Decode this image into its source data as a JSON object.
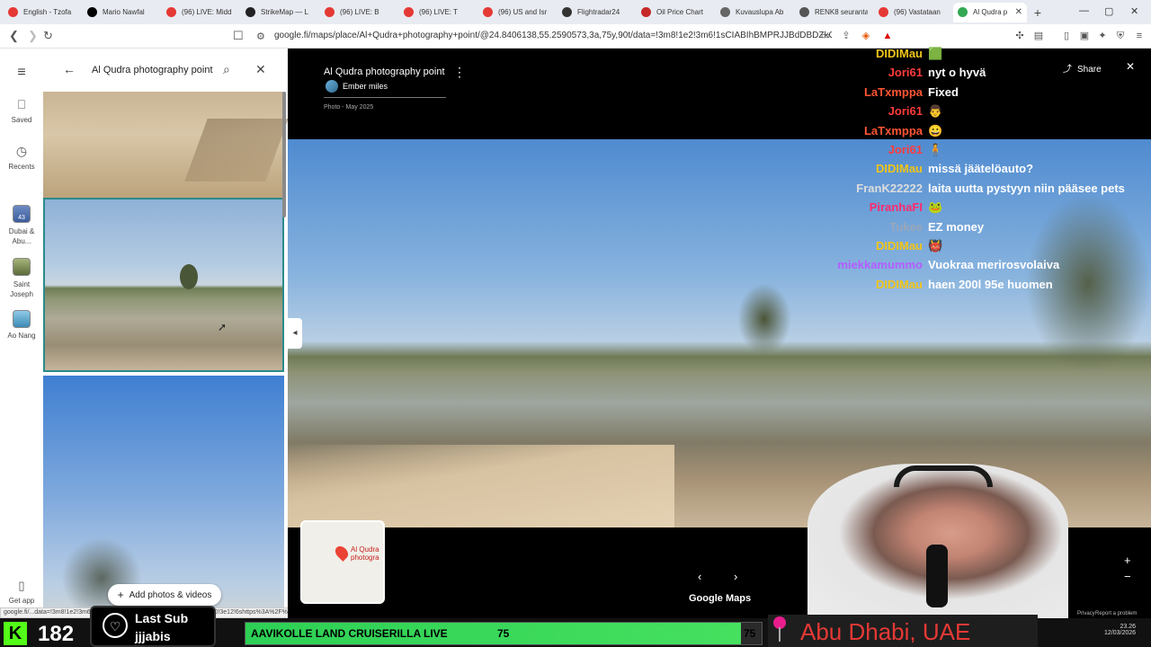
{
  "tabs": [
    {
      "label": "English - Tzofa",
      "color": "#e53935"
    },
    {
      "label": "Mario Nawfal",
      "color": "#000000"
    },
    {
      "label": "(96) LIVE: Midd",
      "color": "#e53935"
    },
    {
      "label": "StrikeMap — L",
      "color": "#222222"
    },
    {
      "label": "(96) LIVE: B",
      "color": "#e53935"
    },
    {
      "label": "(96) LIVE: T",
      "color": "#e53935"
    },
    {
      "label": "(96) US and Isr",
      "color": "#e53935"
    },
    {
      "label": "Flightradar24",
      "color": "#333333"
    },
    {
      "label": "Oil Price Chart",
      "color": "#c62828"
    },
    {
      "label": "Kuvauslupa Ab",
      "color": "#666666"
    },
    {
      "label": "RENK8 seuranta",
      "color": "#555555"
    },
    {
      "label": "(96) Vastataan",
      "color": "#e53935"
    },
    {
      "label": "Al Qudra p",
      "color": "#34a853"
    }
  ],
  "url": "google.fi/maps/place/Al+Qudra+photography+point/@24.8406138,55.2590573,3a,75y,90t/data=!3m8!1e2!3m6!1sCIABIhBMPRJJBdDBDZkGgV...",
  "rail": {
    "saved": "Saved",
    "recents": "Recents",
    "recent_items": [
      {
        "label": "Dubai & Abu...",
        "badge": "43"
      },
      {
        "label": "Saint Joseph"
      },
      {
        "label": "Ao Nang"
      }
    ],
    "get_app": "Get app"
  },
  "search": {
    "value": "Al Qudra photography point"
  },
  "panel": {
    "add_photos": "Add photos & videos",
    "status_url": "google.fi/...data=!3m8!1e2!3m6!1sCIABIhBMPRJJBdDBDZkGgV...CONl2e10!3e12!6shttps%3A%2F%2Flh3.googleuserco..."
  },
  "viewer": {
    "place_title": "Al Qudra photography point",
    "author": "Ember miles",
    "photo_date": "Photo - May 2025",
    "share": "Share",
    "minimap_label": "Al Qudra photogra",
    "brand": "Google Maps",
    "terms": "Privacy",
    "report": "Report a problem"
  },
  "chat": [
    {
      "name": "DIDIMau",
      "msg": "🟩",
      "color": "#f0c419"
    },
    {
      "name": "Jori61",
      "msg": "nyt o hyvä",
      "color": "#ff3b3b"
    },
    {
      "name": "LaTxmppa",
      "msg": "Fixed",
      "color": "#ff5533"
    },
    {
      "name": "Jori61",
      "msg": "👨",
      "color": "#ff3b3b"
    },
    {
      "name": "LaTxmppa",
      "msg": "😀",
      "color": "#ff5533"
    },
    {
      "name": "Jori61",
      "msg": "🧍",
      "color": "#ff3b3b"
    },
    {
      "name": "DIDIMau",
      "msg": "missä jäätelöauto?",
      "color": "#f0c419"
    },
    {
      "name": "FranK22222",
      "msg": "laita uutta pystyyn niin pääsee pets",
      "color": "#dddddd"
    },
    {
      "name": "PiranhaFI",
      "msg": "🐸",
      "color": "#ff2a6d"
    },
    {
      "name": "Tukee",
      "msg": "EZ money",
      "color": "#9aa6b8"
    },
    {
      "name": "DIDIMau",
      "msg": "👹",
      "color": "#f0c419"
    },
    {
      "name": "miekkamummo",
      "msg": "Vuokraa merirosvolaiva",
      "color": "#b65cff"
    },
    {
      "name": "DIDIMau",
      "msg": "haen 200l 95e huomen",
      "color": "#f0c419"
    }
  ],
  "stream": {
    "count": "182",
    "last_sub_label": "Last Sub",
    "last_sub_user": "jjjabis",
    "title": "AAVIKOLLE LAND CRUISERILLA LIVE",
    "goal_left": "75",
    "goal_right": "75",
    "goal_progress": 0.96,
    "location": "Abu Dhabi, UAE",
    "clock_time": "23.26",
    "clock_date": "12/03/2026"
  },
  "colors": {
    "accent": "#1a73e8",
    "kick_green": "#53fc18",
    "goal_green": "#3ce45a"
  }
}
